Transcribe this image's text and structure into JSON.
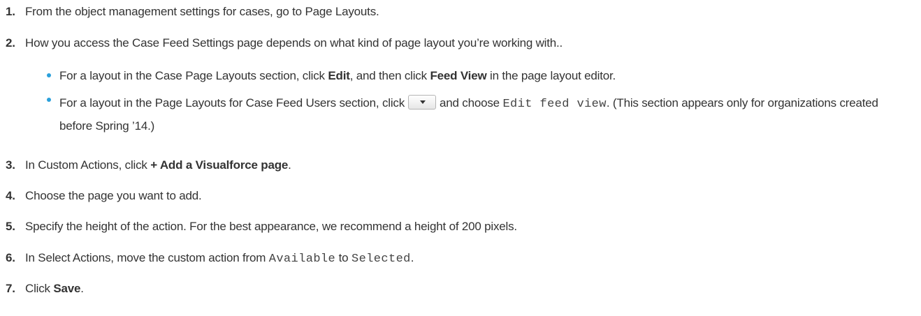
{
  "colors": {
    "text": "#333333",
    "bullet": "#2aa0db"
  },
  "steps": [
    {
      "num": "1.",
      "text": "From the object management settings for cases, go to Page Layouts."
    },
    {
      "num": "2.",
      "text": "How you access the Case Feed Settings page depends on what kind of page layout you’re working with..",
      "bullets": [
        {
          "pre": "For a layout in the Case Page Layouts section, click ",
          "bold1": "Edit",
          "mid": ", and then click ",
          "bold2": "Feed View",
          "post": " in the page layout editor."
        },
        {
          "pre": "For a layout in the Page Layouts for Case Feed Users section, click",
          "icon": "chevron-down-icon",
          "mid": "and choose ",
          "code": "Edit feed view",
          "post": ". (This section appears only for organizations created before Spring ’14.)"
        }
      ]
    },
    {
      "num": "3.",
      "pre": "In Custom Actions, click ",
      "bold": "+ Add a Visualforce page",
      "post": "."
    },
    {
      "num": "4.",
      "text": "Choose the page you want to add."
    },
    {
      "num": "5.",
      "text": "Specify the height of the action. For the best appearance, we recommend a height of 200 pixels."
    },
    {
      "num": "6.",
      "pre": "In Select Actions, move the custom action from ",
      "code1": "Available",
      "mid": " to ",
      "code2": "Selected",
      "post": "."
    },
    {
      "num": "7.",
      "pre": "Click ",
      "bold": "Save",
      "post": "."
    }
  ]
}
